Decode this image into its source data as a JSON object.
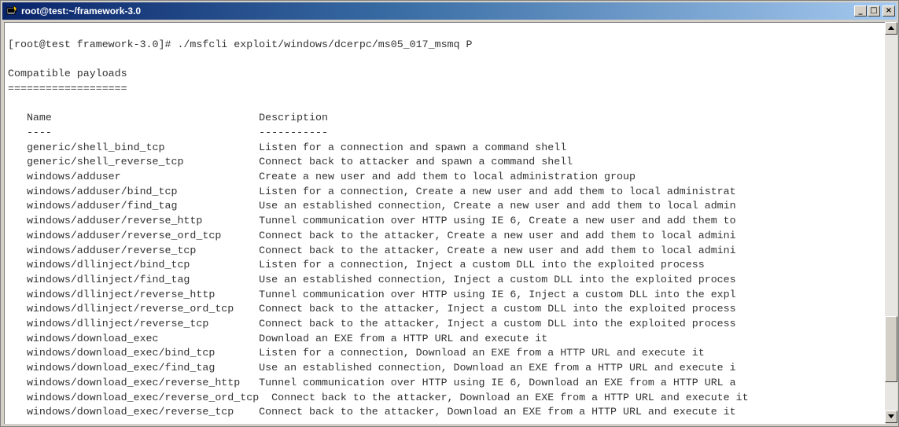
{
  "window": {
    "title": "root@test:~/framework-3.0",
    "icon": "putty-terminal-icon",
    "buttons": {
      "minimize": "_",
      "maximize": "□",
      "close": "×"
    }
  },
  "terminal": {
    "lines": [
      "",
      "[root@test framework-3.0]# ./msfcli exploit/windows/dcerpc/ms05_017_msmq P",
      "",
      "Compatible payloads",
      "===================",
      "",
      "   Name                                 Description",
      "   ----                                 -----------",
      "   generic/shell_bind_tcp               Listen for a connection and spawn a command shell",
      "   generic/shell_reverse_tcp            Connect back to attacker and spawn a command shell",
      "   windows/adduser                      Create a new user and add them to local administration group",
      "   windows/adduser/bind_tcp             Listen for a connection, Create a new user and add them to local administrat",
      "   windows/adduser/find_tag             Use an established connection, Create a new user and add them to local admin",
      "   windows/adduser/reverse_http         Tunnel communication over HTTP using IE 6, Create a new user and add them to",
      "   windows/adduser/reverse_ord_tcp      Connect back to the attacker, Create a new user and add them to local admini",
      "   windows/adduser/reverse_tcp          Connect back to the attacker, Create a new user and add them to local admini",
      "   windows/dllinject/bind_tcp           Listen for a connection, Inject a custom DLL into the exploited process",
      "   windows/dllinject/find_tag           Use an established connection, Inject a custom DLL into the exploited proces",
      "   windows/dllinject/reverse_http       Tunnel communication over HTTP using IE 6, Inject a custom DLL into the expl",
      "   windows/dllinject/reverse_ord_tcp    Connect back to the attacker, Inject a custom DLL into the exploited process",
      "   windows/dllinject/reverse_tcp        Connect back to the attacker, Inject a custom DLL into the exploited process",
      "   windows/download_exec                Download an EXE from a HTTP URL and execute it",
      "   windows/download_exec/bind_tcp       Listen for a connection, Download an EXE from a HTTP URL and execute it",
      "   windows/download_exec/find_tag       Use an established connection, Download an EXE from a HTTP URL and execute i",
      "   windows/download_exec/reverse_http   Tunnel communication over HTTP using IE 6, Download an EXE from a HTTP URL a",
      "   windows/download_exec/reverse_ord_tcp  Connect back to the attacker, Download an EXE from a HTTP URL and execute it",
      "   windows/download_exec/reverse_tcp    Connect back to the attacker, Download an EXE from a HTTP URL and execute it"
    ]
  },
  "scrollbar": {
    "position_fraction": 0.85
  }
}
